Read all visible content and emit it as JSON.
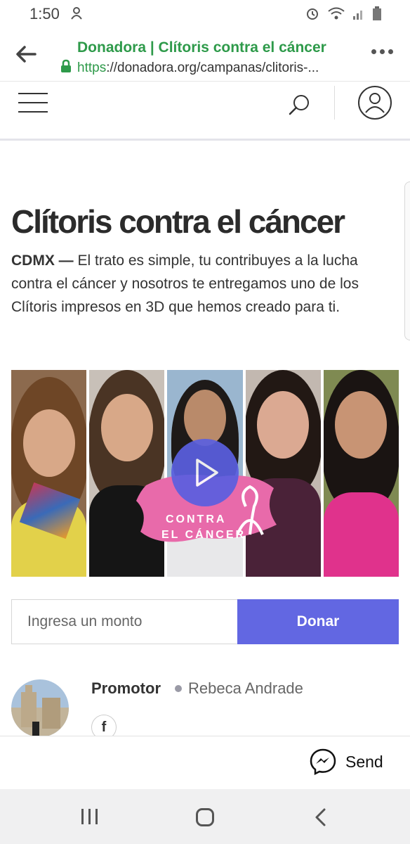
{
  "status_bar": {
    "time": "1:50"
  },
  "browser": {
    "page_title": "Donadora | Clítoris contra el cáncer",
    "url_scheme": "https",
    "url_rest": "://donadora.org/campanas/clitoris-...",
    "accent_color": "#2e9a4a"
  },
  "campaign": {
    "title": "Clítoris contra el cáncer",
    "location": "CDMX —",
    "description": " El trato es simple, tu contribuyes a la lucha contra el cáncer y nosotros te entregamos uno de los Clítoris impresos en 3D que hemos creado para ti.",
    "video_logo_line1": "CONTRA",
    "video_logo_line2": "EL CÁNCER"
  },
  "donation": {
    "amount_placeholder": "Ingresa un monto",
    "donate_label": "Donar",
    "button_color": "#6267e2"
  },
  "promoter": {
    "role": "Promotor",
    "name": "Rebeca Andrade",
    "facebook_glyph": "f"
  },
  "share": {
    "send_label": "Send"
  }
}
